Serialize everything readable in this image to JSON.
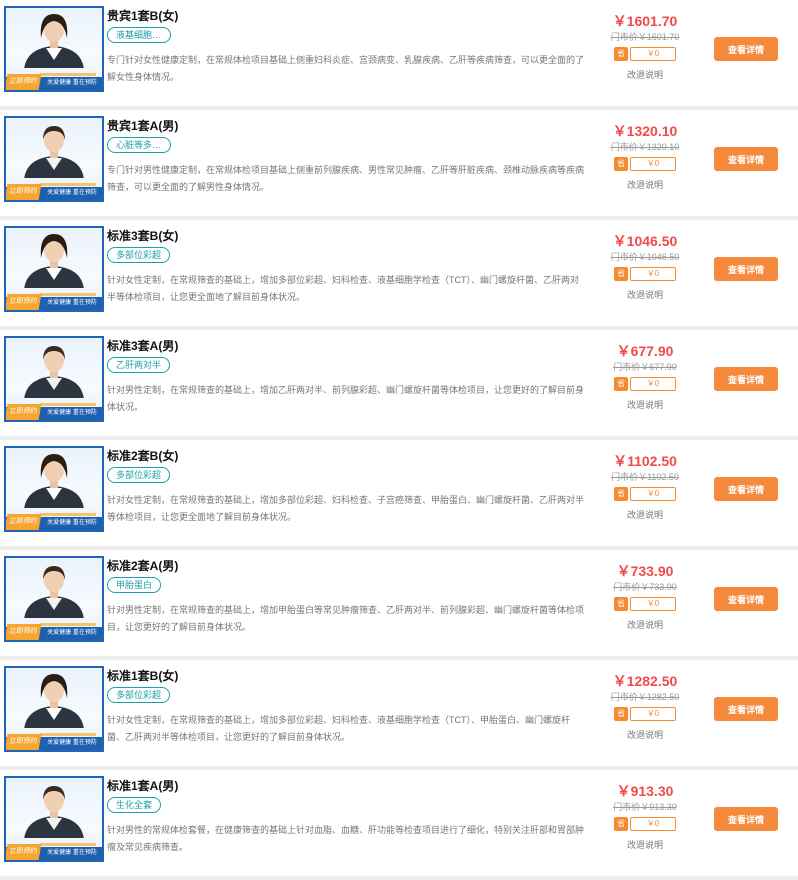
{
  "thumb": {
    "book_label": "立即预约",
    "slogan": "关爱健康  重在预防"
  },
  "coupon_badge": "省",
  "detail_label": "查看详情",
  "explain_label": "改退说明",
  "colors": {
    "price": "#f04a4a",
    "tag": "#1aa0a8",
    "button": "#f58a3c",
    "thumb_border": "#1f66b8"
  },
  "items": [
    {
      "title": "贵宾1套B(女)",
      "tag": "液基细胞学...",
      "desc": "专门针对女性健康定制，在常规体检项目基础上侧重妇科炎症、宫颈病变、乳腺疾病、乙肝等疾病筛查，可以更全面的了解女性身体情况。",
      "price": "￥1601.70",
      "market": "门市价￥1601.70",
      "coupon": "￥0",
      "gender": "female"
    },
    {
      "title": "贵宾1套A(男)",
      "tag": "心脏等多部...",
      "desc": "专门针对男性健康定制，在常规体检项目基础上侧重前列腺疾病、男性常见肿瘤、乙肝等肝脏疾病、颈椎动脉疾病等疾病筛查，可以更全面的了解男性身体情况。",
      "price": "￥1320.10",
      "market": "门市价￥1320.10",
      "coupon": "￥0",
      "gender": "male"
    },
    {
      "title": "标准3套B(女)",
      "tag": "多部位彩超",
      "desc": "针对女性定制，在常规筛查的基础上，增加多部位彩超、妇科检查、液基细胞学检查（TCT）、幽门螺旋杆菌、乙肝两对半等体检项目，让您更全面地了解目前身体状况。",
      "price": "￥1046.50",
      "market": "门市价￥1046.50",
      "coupon": "￥0",
      "gender": "female"
    },
    {
      "title": "标准3套A(男)",
      "tag": "乙肝两对半",
      "desc": "针对男性定制，在常规筛查的基础上，增加乙肝两对半、前列腺彩超、幽门螺旋杆菌等体检项目，让您更好的了解目前身体状况。",
      "price": "￥677.90",
      "market": "门市价￥677.90",
      "coupon": "￥0",
      "gender": "male"
    },
    {
      "title": "标准2套B(女)",
      "tag": "多部位彩超",
      "desc": "针对女性定制，在常规筛查的基础上，增加多部位彩超、妇科检查、子宫癌筛查、甲胎蛋白、幽门螺旋杆菌、乙肝两对半等体检项目，让您更全面地了解目前身体状况。",
      "price": "￥1102.50",
      "market": "门市价￥1102.50",
      "coupon": "￥0",
      "gender": "female"
    },
    {
      "title": "标准2套A(男)",
      "tag": "甲胎蛋白",
      "desc": "针对男性定制，在常规筛查的基础上，增加甲胎蛋白等常见肿瘤筛查、乙肝两对半、前列腺彩超、幽门螺旋杆菌等体检项目，让您更好的了解目前身体状况。",
      "price": "￥733.90",
      "market": "门市价￥733.90",
      "coupon": "￥0",
      "gender": "male"
    },
    {
      "title": "标准1套B(女)",
      "tag": "多部位彩超",
      "desc": "针对女性定制，在常规筛查的基础上，增加多部位彩超、妇科检查、液基细胞学检查（TCT）、甲胎蛋白、幽门螺旋杆菌、乙肝两对半等体检项目，让您更好的了解目前身体状况。",
      "price": "￥1282.50",
      "market": "门市价￥1282.50",
      "coupon": "￥0",
      "gender": "female"
    },
    {
      "title": "标准1套A(男)",
      "tag": "生化全套",
      "desc": "针对男性的常规体检套餐，在健康筛查的基础上针对血脂、血糖、肝功能等检查项目进行了细化，特别关注肝部和胃部肿瘤及常见疾病筛查。",
      "price": "￥913.30",
      "market": "门市价￥913.30",
      "coupon": "￥0",
      "gender": "male"
    }
  ]
}
